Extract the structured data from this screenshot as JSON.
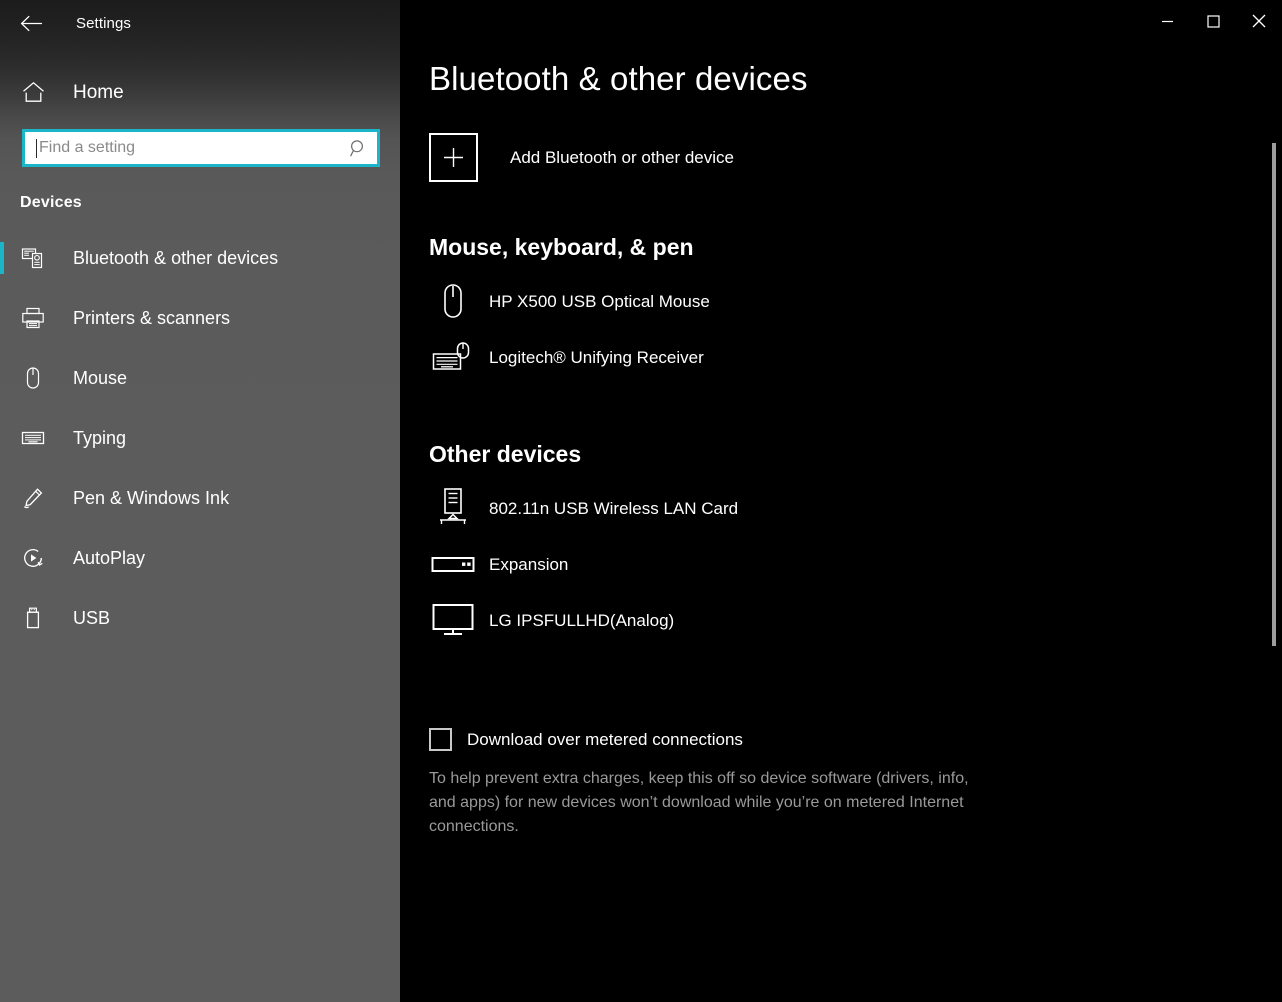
{
  "window": {
    "app_title": "Settings",
    "back_icon": "back-arrow-icon",
    "controls": {
      "minimize": "minimize-icon",
      "maximize": "maximize-icon",
      "close": "close-icon"
    }
  },
  "sidebar": {
    "home_label": "Home",
    "home_icon": "home-icon",
    "search": {
      "placeholder": "Find a setting",
      "value": "",
      "icon": "search-icon"
    },
    "category_heading": "Devices",
    "accent_color": "#1ab5c8",
    "items": [
      {
        "label": "Bluetooth & other devices",
        "icon": "bluetooth-devices-icon",
        "selected": true
      },
      {
        "label": "Printers & scanners",
        "icon": "printer-icon",
        "selected": false
      },
      {
        "label": "Mouse",
        "icon": "mouse-icon",
        "selected": false
      },
      {
        "label": "Typing",
        "icon": "keyboard-icon",
        "selected": false
      },
      {
        "label": "Pen & Windows Ink",
        "icon": "pen-icon",
        "selected": false
      },
      {
        "label": "AutoPlay",
        "icon": "autoplay-icon",
        "selected": false
      },
      {
        "label": "USB",
        "icon": "usb-icon",
        "selected": false
      }
    ]
  },
  "main": {
    "page_title": "Bluetooth & other devices",
    "add_device": {
      "label": "Add Bluetooth or other device",
      "icon": "plus-icon"
    },
    "groups": [
      {
        "heading": "Mouse, keyboard, & pen",
        "devices": [
          {
            "name": "HP X500 USB Optical Mouse",
            "icon": "mouse-device-icon"
          },
          {
            "name": "Logitech® Unifying Receiver",
            "icon": "keyboard-mouse-device-icon"
          }
        ]
      },
      {
        "heading": "Other devices",
        "devices": [
          {
            "name": "802.11n USB Wireless LAN Card",
            "icon": "network-device-icon"
          },
          {
            "name": "Expansion",
            "icon": "external-drive-icon"
          },
          {
            "name": "LG IPSFULLHD(Analog)",
            "icon": "monitor-icon"
          }
        ]
      }
    ],
    "metered": {
      "checkbox_label": "Download over metered connections",
      "checked": false,
      "description": "To help prevent extra charges, keep this off so device software (drivers, info, and apps) for new devices won’t download while you’re on metered Internet connections."
    }
  }
}
